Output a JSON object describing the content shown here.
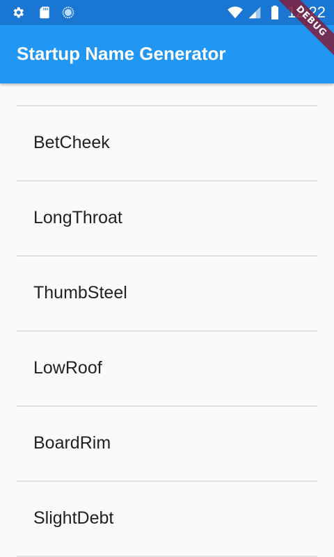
{
  "status_bar": {
    "time": "12:22",
    "left_icons": [
      "gear-icon",
      "sd-card-icon",
      "sync-circle-icon"
    ],
    "right_icons": [
      "wifi-icon",
      "signal-icon",
      "battery-icon"
    ]
  },
  "app_bar": {
    "title": "Startup Name Generator",
    "color": "#2196f3",
    "debug_banner": "DEBUG"
  },
  "list": {
    "items": [
      {
        "label": "BetCheek"
      },
      {
        "label": "LongThroat"
      },
      {
        "label": "ThumbSteel"
      },
      {
        "label": "LowRoof"
      },
      {
        "label": "BoardRim"
      },
      {
        "label": "SlightDebt"
      }
    ]
  }
}
